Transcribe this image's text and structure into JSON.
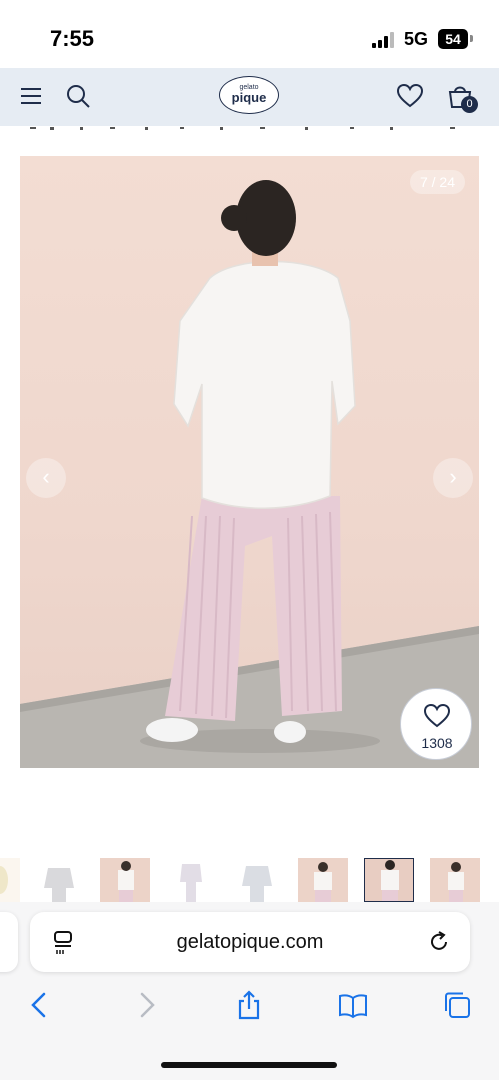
{
  "status_bar": {
    "time": "7:55",
    "network": "5G",
    "battery": "54"
  },
  "header": {
    "logo_small": "gelato",
    "logo_main": "pique",
    "cart_count": "0",
    "icons": [
      "menu-icon",
      "search-icon",
      "heart-icon",
      "cart-icon"
    ]
  },
  "product": {
    "image_counter": "7 / 24",
    "like_count": "1308",
    "prev_arrow": "‹",
    "next_arrow": "›"
  },
  "thumbnails": {
    "count_visible": 8,
    "items": [
      "thumbnail-1",
      "thumbnail-2",
      "thumbnail-3",
      "thumbnail-4",
      "thumbnail-5",
      "thumbnail-6",
      "thumbnail-7",
      "thumbnail-8"
    ]
  },
  "browser": {
    "url": "gelatopique.com",
    "icons": [
      "reader-icon",
      "reload-icon",
      "back-icon",
      "forward-icon",
      "share-icon",
      "bookmarks-icon",
      "tabs-icon"
    ]
  },
  "colors": {
    "header_bg": "#e6ecf3",
    "brand_navy": "#1f2d4a",
    "photo_wall": "#f0d9cf",
    "sweater": "#f7f5f3",
    "pants": "#e8ccd6",
    "ios_blue": "#1a73e8"
  }
}
